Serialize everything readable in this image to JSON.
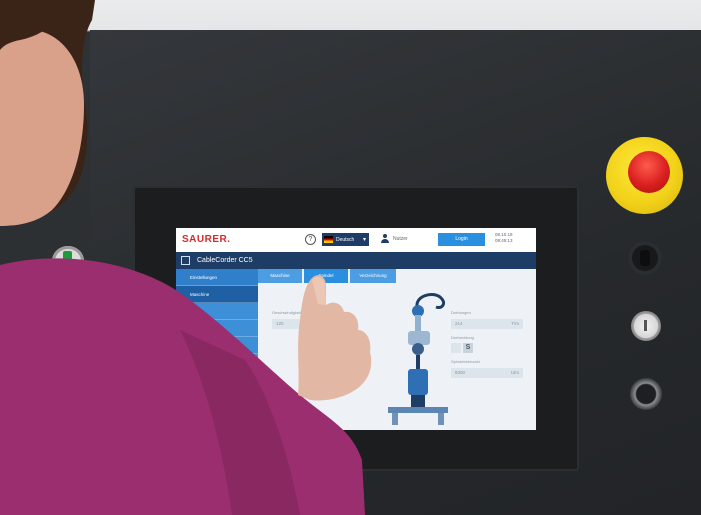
{
  "screen": {
    "brand": "SAURER.",
    "help_glyph": "?",
    "language": "Deutsch",
    "language_chevron": "▾",
    "user_label": "Nutzer",
    "login_button": "Login",
    "date": "08.10.18",
    "time": "09:45:13",
    "app_title": "CableCorder CC5",
    "sidebar": [
      {
        "label": "Einstellungen"
      },
      {
        "label": "Maschine"
      },
      {
        "label": "Spulen"
      },
      {
        "label": "Garne"
      },
      {
        "label": "Produkt"
      },
      {
        "label": "Programmierung"
      }
    ],
    "tabs": [
      "Maschine",
      "Spindel",
      "Verzeichnung"
    ],
    "fields": {
      "left_label": "Geschwindigkeit",
      "left_value": "120",
      "right1_label": "Drehungen",
      "right1_value": "214",
      "right1_unit": "T/m",
      "right2_label": "Drehrichtung",
      "right2_value": "S",
      "right3_label": "Spindeldrehzahl",
      "right3_value": "8300",
      "right3_unit": "U/m"
    }
  },
  "colors": {
    "accent_dark": "#1d3c66",
    "accent_blue": "#3d8fd8",
    "login_blue": "#2b8fe0",
    "brand_red": "#d42a2a",
    "estop_red": "#d91f1f",
    "estop_yellow": "#f2d21a",
    "sleeve": "#9a2e6e"
  },
  "icons": [
    "help-icon",
    "flag-de-icon",
    "user-icon",
    "app-grid-icon"
  ]
}
